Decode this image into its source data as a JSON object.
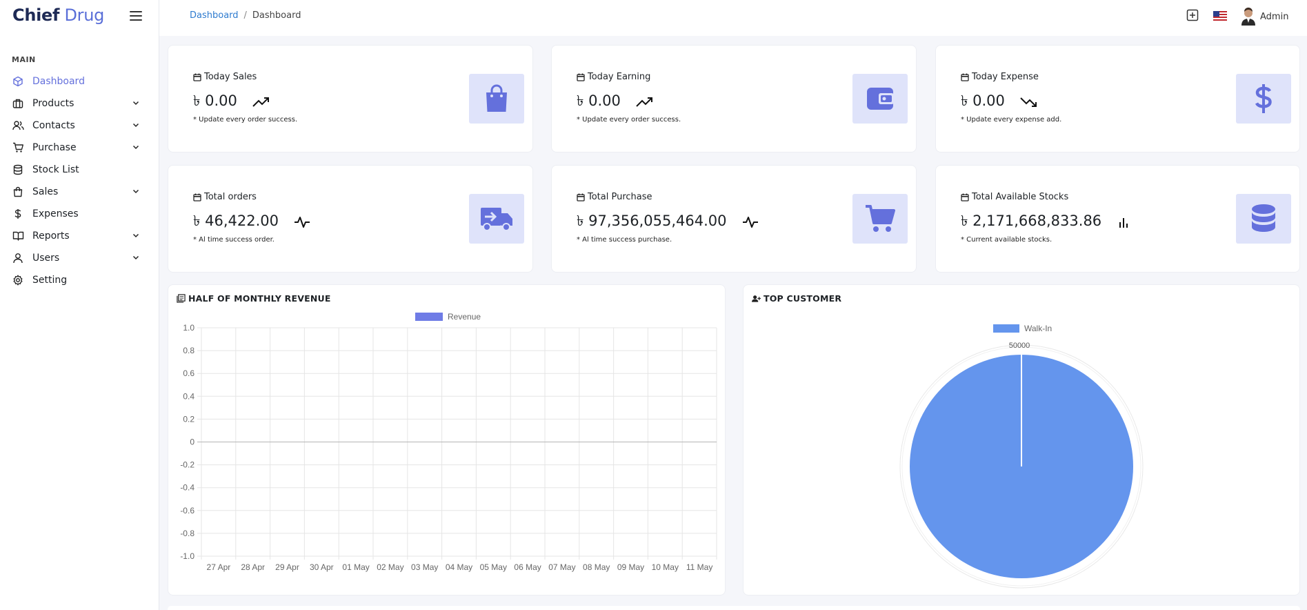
{
  "brand": {
    "part1": "Chief",
    "part2": "Drug"
  },
  "sidebar": {
    "caption": "MAIN",
    "items": [
      {
        "label": "Dashboard",
        "icon": "cube-icon",
        "active": true,
        "expandable": false
      },
      {
        "label": "Products",
        "icon": "briefcase-icon",
        "active": false,
        "expandable": true
      },
      {
        "label": "Contacts",
        "icon": "users-icon",
        "active": false,
        "expandable": true
      },
      {
        "label": "Purchase",
        "icon": "cart-icon",
        "active": false,
        "expandable": true
      },
      {
        "label": "Stock List",
        "icon": "database-icon",
        "active": false,
        "expandable": false
      },
      {
        "label": "Sales",
        "icon": "shopping-bag-icon",
        "active": false,
        "expandable": true
      },
      {
        "label": "Expenses",
        "icon": "dollar-icon",
        "active": false,
        "expandable": false
      },
      {
        "label": "Reports",
        "icon": "book-icon",
        "active": false,
        "expandable": true
      },
      {
        "label": "Users",
        "icon": "user-icon",
        "active": false,
        "expandable": true
      },
      {
        "label": "Setting",
        "icon": "gear-icon",
        "active": false,
        "expandable": false
      }
    ]
  },
  "header": {
    "breadcrumb": {
      "link": "Dashboard",
      "separator": "/",
      "current": "Dashboard"
    },
    "user": "Admin"
  },
  "stats": [
    {
      "title": "Today Sales",
      "value": "৳ 0.00",
      "note": "* Update every order success.",
      "trend": "trending-up-icon",
      "tile_icon": "shopping-bag-icon"
    },
    {
      "title": "Today Earning",
      "value": "৳ 0.00",
      "note": "* Update every order success.",
      "trend": "trending-up-icon",
      "tile_icon": "wallet-icon"
    },
    {
      "title": "Today Expense",
      "value": "৳ 0.00",
      "note": "* Update every expense add.",
      "trend": "trending-down-icon",
      "tile_icon": "dollar-icon"
    },
    {
      "title": "Total orders",
      "value": "৳ 46,422.00",
      "note": "* Al time success order.",
      "trend": "activity-icon",
      "tile_icon": "truck-icon"
    },
    {
      "title": "Total Purchase",
      "value": "৳ 97,356,055,464.00",
      "note": "* Al time success purchase.",
      "trend": "activity-icon",
      "tile_icon": "cart-icon"
    },
    {
      "title": "Total Available Stocks",
      "value": "৳ 2,171,668,833.86",
      "note": "* Current available stocks.",
      "trend": "bar-chart-icon",
      "tile_icon": "database-icon"
    }
  ],
  "colors": {
    "accent": "#6470dc",
    "tile_bg": "#dfe3fa",
    "revenue": "#6f7ce6",
    "pie": "#6495ed"
  },
  "revenue_panel": {
    "title": "HALF OF MONTHLY REVENUE"
  },
  "customer_panel": {
    "title": "TOP CUSTOMER"
  },
  "chart_data": [
    {
      "type": "line",
      "title": "HALF OF MONTHLY REVENUE",
      "categories": [
        "27 Apr",
        "28 Apr",
        "29 Apr",
        "30 Apr",
        "01 May",
        "02 May",
        "03 May",
        "04 May",
        "05 May",
        "06 May",
        "07 May",
        "08 May",
        "09 May",
        "10 May",
        "11 May"
      ],
      "series": [
        {
          "name": "Revenue",
          "values": []
        }
      ],
      "yticks": [
        "1.0",
        "0.8",
        "0.6",
        "0.4",
        "0.2",
        "0",
        "-0.2",
        "-0.4",
        "-0.6",
        "-0.8",
        "-1.0"
      ],
      "ylim": [
        -1,
        1
      ],
      "grid": true,
      "legend": "top"
    },
    {
      "type": "pie",
      "title": "TOP CUSTOMER",
      "labels": [
        "Walk-In"
      ],
      "values": [
        50000
      ],
      "value_label": "50000",
      "legend": "top"
    }
  ]
}
